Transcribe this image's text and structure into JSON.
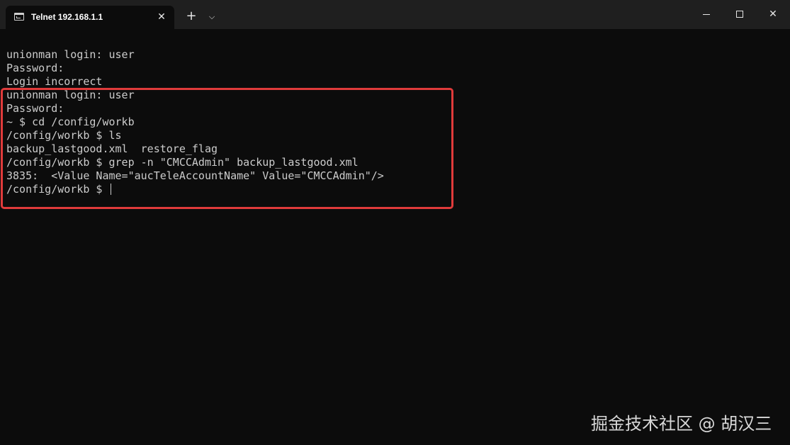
{
  "window": {
    "tab_title": "Telnet 192.168.1.1",
    "tab_icon": "terminal-icon",
    "close_tab_glyph": "✕",
    "new_tab_glyph": "+",
    "dropdown_glyph": "⌵",
    "minimize_icon": "minimize-icon",
    "maximize_icon": "maximize-icon",
    "close_glyph": "✕"
  },
  "terminal": {
    "lines": [
      "unionman login: user",
      "Password:",
      "Login incorrect",
      "unionman login: user",
      "Password:",
      "~ $ cd /config/workb",
      "/config/workb $ ls",
      "backup_lastgood.xml  restore_flag",
      "/config/workb $ grep -n \"CMCCAdmin\" backup_lastgood.xml",
      "3835:  <Value Name=\"aucTeleAccountName\" Value=\"CMCCAdmin\"/>",
      "/config/workb $ "
    ]
  },
  "annotation": {
    "color": "#e03b3b"
  },
  "watermark": {
    "text": "掘金技术社区 @ 胡汉三"
  }
}
